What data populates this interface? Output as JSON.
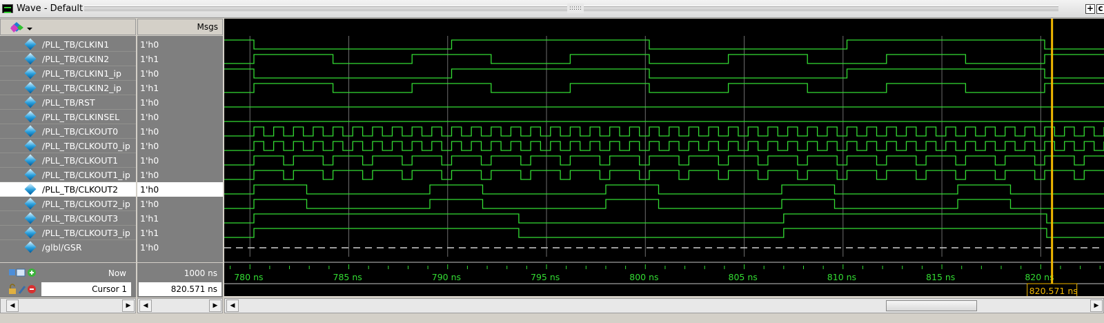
{
  "window": {
    "title": "Wave - Default",
    "dots": "::::::",
    "btn_add": "+",
    "btn_more": "c"
  },
  "columns": {
    "msgs": "Msgs"
  },
  "signals": [
    {
      "name": "/PLL_TB/CLKIN1",
      "value": "1'h0"
    },
    {
      "name": "/PLL_TB/CLKIN2",
      "value": "1'h1"
    },
    {
      "name": "/PLL_TB/CLKIN1_ip",
      "value": "1'h0"
    },
    {
      "name": "/PLL_TB/CLKIN2_ip",
      "value": "1'h1"
    },
    {
      "name": "/PLL_TB/RST",
      "value": "1'h0"
    },
    {
      "name": "/PLL_TB/CLKINSEL",
      "value": "1'h0"
    },
    {
      "name": "/PLL_TB/CLKOUT0",
      "value": "1'h0"
    },
    {
      "name": "/PLL_TB/CLKOUT0_ip",
      "value": "1'h0"
    },
    {
      "name": "/PLL_TB/CLKOUT1",
      "value": "1'h0"
    },
    {
      "name": "/PLL_TB/CLKOUT1_ip",
      "value": "1'h0"
    },
    {
      "name": "/PLL_TB/CLKOUT2",
      "value": "1'h0",
      "selected": true
    },
    {
      "name": "/PLL_TB/CLKOUT2_ip",
      "value": "1'h0"
    },
    {
      "name": "/PLL_TB/CLKOUT3",
      "value": "1'h1"
    },
    {
      "name": "/PLL_TB/CLKOUT3_ip",
      "value": "1'h1"
    },
    {
      "name": "/glbl/GSR",
      "value": "1'h0"
    }
  ],
  "status": {
    "now_label": "Now",
    "now_value": "1000 ns",
    "cursor_label": "Cursor 1",
    "cursor_value": "820.571 ns"
  },
  "timeline": {
    "start_ns": 778.7,
    "end_ns": 823.2,
    "major_ticks": [
      780,
      785,
      790,
      795,
      800,
      805,
      810,
      815,
      820
    ],
    "tick_labels": [
      "780 ns",
      "785 ns",
      "790 ns",
      "795 ns",
      "800 ns",
      "805 ns",
      "810 ns",
      "815 ns",
      "820 ns"
    ],
    "minor_step_ns": 1,
    "cursor_ns": 820.571,
    "cursor_label": "820.571 ns"
  },
  "waves": {
    "CLKIN1": {
      "initial": 1,
      "edges": [
        780.2,
        790.2,
        800.2,
        810.2,
        820.2
      ]
    },
    "CLKIN2": {
      "initial": 0,
      "edges": [
        780.2,
        784.2,
        788.2,
        792.2,
        796.2,
        800.2,
        804.2,
        808.2,
        812.2,
        816.2,
        820.2
      ]
    },
    "CLKIN1_ip": {
      "initial": 1,
      "edges": [
        780.2,
        790.2,
        800.2,
        810.2,
        820.2
      ]
    },
    "CLKIN2_ip": {
      "initial": 0,
      "edges": [
        780.2,
        784.2,
        788.2,
        792.2,
        796.2,
        800.2,
        804.2,
        808.2,
        812.2,
        816.2,
        820.2
      ]
    },
    "RST": {
      "initial": 0,
      "edges": []
    },
    "CLKINSEL": {
      "initial": 0,
      "edges": []
    },
    "CLKOUT0": {
      "initial": 0,
      "start": 780.2,
      "period": 1.0,
      "duty": 0.5,
      "phase": 1
    },
    "CLKOUT0_ip": {
      "initial": 0,
      "start": 780.2,
      "period": 1.0,
      "duty": 0.5,
      "phase": 1
    },
    "CLKOUT1": {
      "initial": 0,
      "start": 780.2,
      "period": 2.0,
      "duty": 0.75,
      "phase": 1
    },
    "CLKOUT1_ip": {
      "initial": 0,
      "start": 780.2,
      "period": 2.0,
      "duty": 0.75,
      "phase": 1
    },
    "CLKOUT2": {
      "initial": 0,
      "start": 780.2,
      "period": 8.9,
      "duty": 0.3,
      "phase": 1
    },
    "CLKOUT2_ip": {
      "initial": 0,
      "start": 780.2,
      "period": 8.9,
      "duty": 0.3,
      "phase": 1
    },
    "CLKOUT3": {
      "initial": 0,
      "edges": [
        780.2,
        793.6,
        807.0,
        820.3
      ]
    },
    "CLKOUT3_ip": {
      "initial": 0,
      "edges": [
        780.2,
        793.6,
        807.0,
        820.3
      ]
    },
    "GSR": {
      "dashed": true
    }
  },
  "colors": {
    "wave": "#33dd33",
    "cursor": "#f2b800",
    "background": "#000000",
    "grid": "#6e6e6e"
  }
}
